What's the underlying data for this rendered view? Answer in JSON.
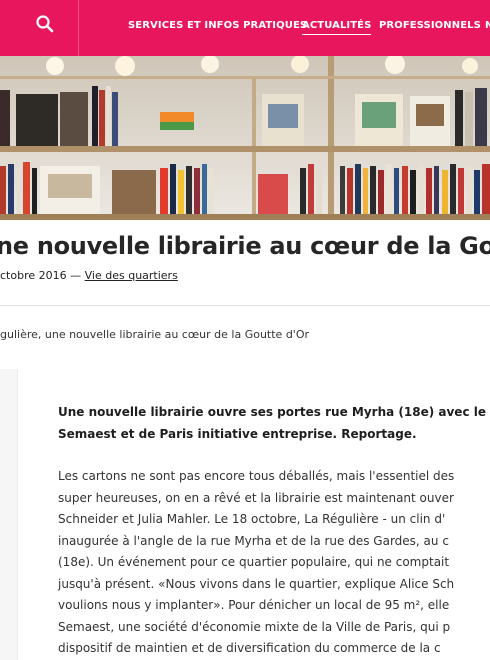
{
  "header": {
    "nav": [
      {
        "label": "SERVICES ET INFOS PRATIQUES",
        "active": false
      },
      {
        "label": "ACTUALITÉS",
        "active": true
      },
      {
        "label": "PROFESSIONNELS",
        "active": false
      },
      {
        "label": "N",
        "active": false
      }
    ],
    "brand_color": "#e8175d"
  },
  "hero": {
    "icon": "bookshelf-photo"
  },
  "article": {
    "title": "ne nouvelle librairie au cœur de la Go",
    "date": "ctobre 2016",
    "separator": " — ",
    "category": "Vie des quartiers",
    "breadcrumb": "gulière, une nouvelle librairie au cœur de la Goutte d'Or",
    "lead_lines": [
      "Une nouvelle librairie ouvre ses portes rue Myrha (18e) avec le so",
      "Semaest et de Paris initiative entreprise. Reportage."
    ],
    "body_lines": [
      "Les cartons ne sont pas encore tous déballés, mais l'essentiel des",
      "super heureuses, on en a rêvé et la librairie est maintenant ouver",
      "Schneider et Julia Mahler. Le 18 octobre, La Régulière - un clin d'",
      "inaugurée à l'angle de la rue Myrha et de la rue des Gardes, au c",
      "(18e). Un événement pour ce quartier populaire, qui ne comptait",
      "jusqu'à présent. «Nous vivons dans le quartier, explique Alice Sch",
      "voulions nous y implanter». Pour dénicher un local de 95 m², elle",
      "Semaest, une société d'économie mixte de la Ville de Paris, qui p",
      "dispositif de maintien et de diversification du commerce de la c"
    ]
  }
}
